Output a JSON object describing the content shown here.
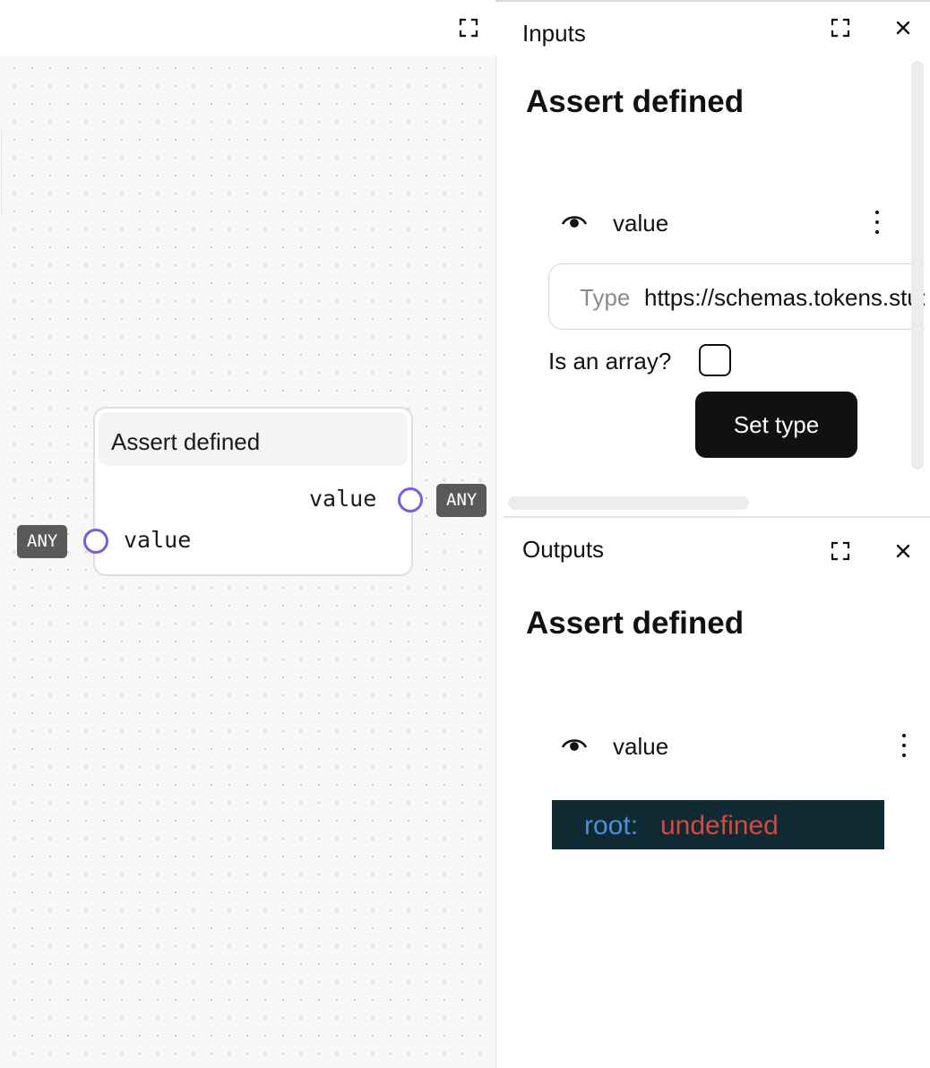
{
  "canvas": {
    "node": {
      "title": "Assert defined",
      "output": {
        "label": "value",
        "type": "ANY"
      },
      "input": {
        "label": "value",
        "type": "ANY"
      }
    }
  },
  "inputs_panel": {
    "tab": "Inputs",
    "heading": "Assert defined",
    "field": {
      "name": "value"
    },
    "type_label": "Type",
    "type_value": "https://schemas.tokens.studio/tokens/generic/any.json",
    "array_label": "Is an array?",
    "array_checked": false,
    "set_type_label": "Set type"
  },
  "outputs_panel": {
    "tab": "Outputs",
    "heading": "Assert defined",
    "field": {
      "name": "value"
    },
    "json": {
      "key": "root:",
      "value": "undefined"
    }
  },
  "colors": {
    "port_ring": "#7c5cd8",
    "type_chip": "#595959",
    "json_bg": "#0f2a33",
    "json_key": "#4a90d9",
    "json_value": "#d9473f"
  },
  "icons": [
    "fullscreen-icon",
    "close-icon",
    "eye-icon",
    "kebab-menu-icon"
  ]
}
